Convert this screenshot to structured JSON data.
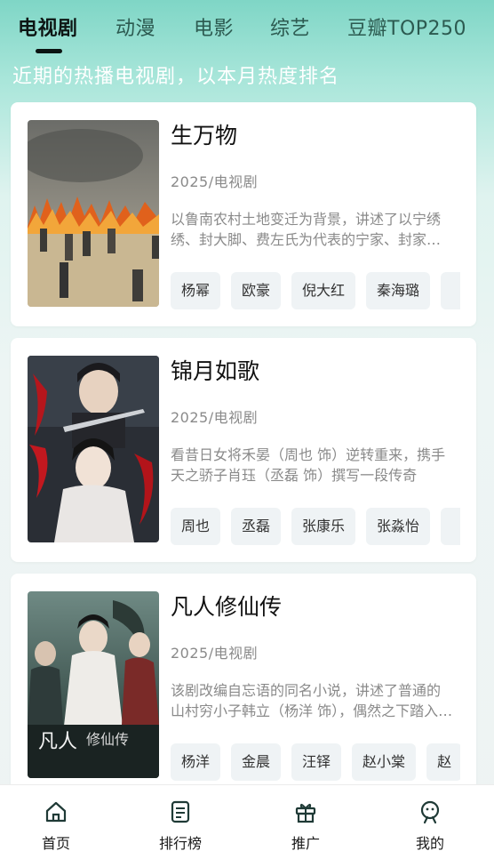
{
  "tabs": [
    {
      "label": "电视剧",
      "active": true
    },
    {
      "label": "动漫"
    },
    {
      "label": "电影"
    },
    {
      "label": "综艺"
    },
    {
      "label": "豆瓣TOP250"
    }
  ],
  "subtitle": "近期的热播电视剧，以本月热度排名",
  "cards": [
    {
      "title": "生万物",
      "meta": "2025/电视剧",
      "desc": "以鲁南农村土地变迁为背景，讲述了以宁绣绣、封大脚、费左氏为代表的宁家、封家、费家三家人的故事",
      "tags": [
        "杨幂",
        "欧豪",
        "倪大红",
        "秦海璐",
        ""
      ]
    },
    {
      "title": "锦月如歌",
      "meta": "2025/电视剧",
      "desc": "看昔日女将禾晏（周也 饰）逆转重来，携手天之骄子肖珏（丞磊 饰）撰写一段传奇",
      "tags": [
        "周也",
        "丞磊",
        "张康乐",
        "张淼怡",
        ""
      ]
    },
    {
      "title": "凡人修仙传",
      "meta": "2025/电视剧",
      "desc": "该剧改编自忘语的同名小说，讲述了普通的山村穷小子韩立（杨洋 饰），偶然之下踏入修仙之路",
      "tags": [
        "杨洋",
        "金晨",
        "汪铎",
        "赵小棠",
        "赵"
      ]
    }
  ],
  "bottom_nav": [
    {
      "label": "首页",
      "icon": "home-icon"
    },
    {
      "label": "排行榜",
      "icon": "ranking-icon"
    },
    {
      "label": "推广",
      "icon": "gift-icon"
    },
    {
      "label": "我的",
      "icon": "profile-icon"
    }
  ],
  "colors": {
    "accent": "#0b1412",
    "header_gradient_top": "#7fd6c6",
    "background": "#eef3f3"
  }
}
